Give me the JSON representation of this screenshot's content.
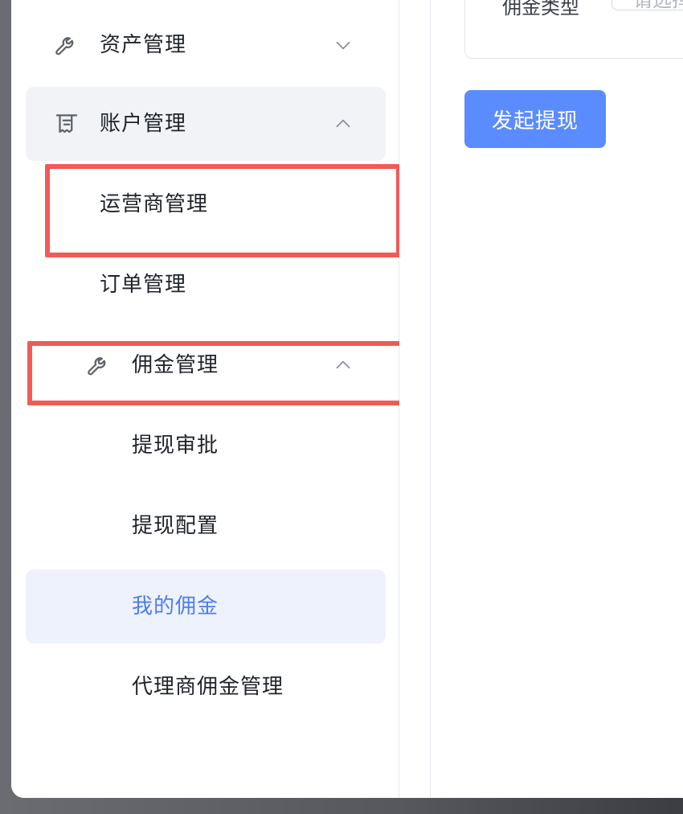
{
  "colors": {
    "accent": "#5b8cff",
    "active_text": "#4f7cf3",
    "active_bg": "#edf2fd",
    "highlight_box": "#f25a57"
  },
  "sidebar": {
    "items": [
      {
        "label": "资产管理",
        "icon": "wrench-icon",
        "chevron": "chevron-down-icon"
      },
      {
        "label": "账户管理",
        "icon": "receipt-icon",
        "chevron": "chevron-up-icon"
      },
      {
        "label": "运营商管理"
      },
      {
        "label": "订单管理"
      },
      {
        "label": "佣金管理",
        "icon": "wrench-icon",
        "chevron": "chevron-up-icon"
      },
      {
        "label": "提现审批"
      },
      {
        "label": "提现配置"
      },
      {
        "label": "我的佣金",
        "active": true
      },
      {
        "label": "代理商佣金管理"
      }
    ]
  },
  "main": {
    "filter_label": "佣金类型",
    "filter_placeholder": "请选择",
    "withdraw_button": "发起提现"
  }
}
